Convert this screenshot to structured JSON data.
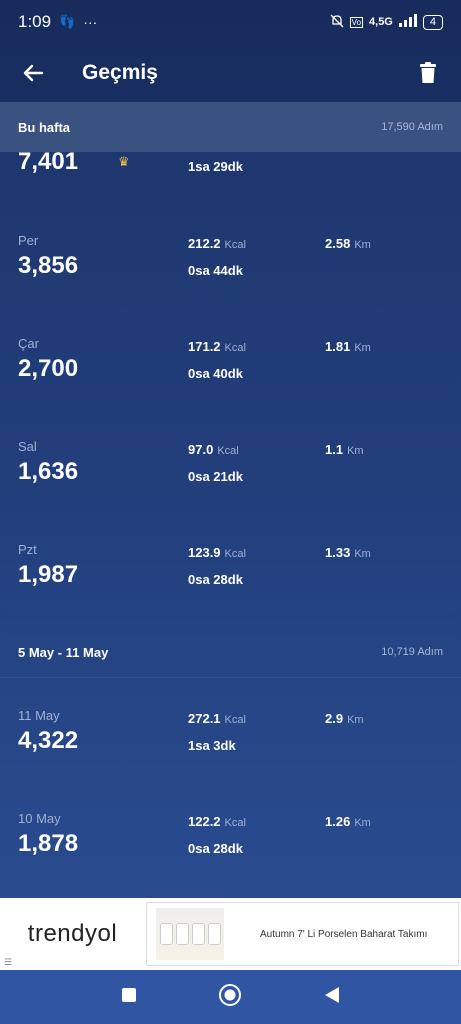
{
  "status": {
    "time": "1:09",
    "network": "4,5G",
    "battery": "4"
  },
  "header": {
    "title": "Geçmiş"
  },
  "weeks": [
    {
      "label": "Bu hafta",
      "total": "17,590 Adım",
      "days": [
        {
          "day": "",
          "steps": "7,401",
          "kcal": "",
          "duration": "1sa 29dk",
          "km": "",
          "crown": true
        },
        {
          "day": "Per",
          "steps": "3,856",
          "kcal": "212.2",
          "duration": "0sa 44dk",
          "km": "2.58"
        },
        {
          "day": "Çar",
          "steps": "2,700",
          "kcal": "171.2",
          "duration": "0sa 40dk",
          "km": "1.81"
        },
        {
          "day": "Sal",
          "steps": "1,636",
          "kcal": "97.0",
          "duration": "0sa 21dk",
          "km": "1.1"
        },
        {
          "day": "Pzt",
          "steps": "1,987",
          "kcal": "123.9",
          "duration": "0sa 28dk",
          "km": "1.33"
        }
      ]
    },
    {
      "label": "5 May - 11 May",
      "total": "10,719 Adım",
      "days": [
        {
          "day": "11 May",
          "steps": "4,322",
          "kcal": "272.1",
          "duration": "1sa 3dk",
          "km": "2.9"
        },
        {
          "day": "10 May",
          "steps": "1,878",
          "kcal": "122.2",
          "duration": "0sa 28dk",
          "km": "1.26"
        }
      ]
    }
  ],
  "units": {
    "kcal": "Kcal",
    "km": "Km"
  },
  "ad": {
    "brand": "trendyol",
    "text": "Autumn 7' Li Porselen Baharat Takımı"
  },
  "colors": {
    "accent_gold": "#f2c14e",
    "nav_bar": "#2f55a3"
  }
}
